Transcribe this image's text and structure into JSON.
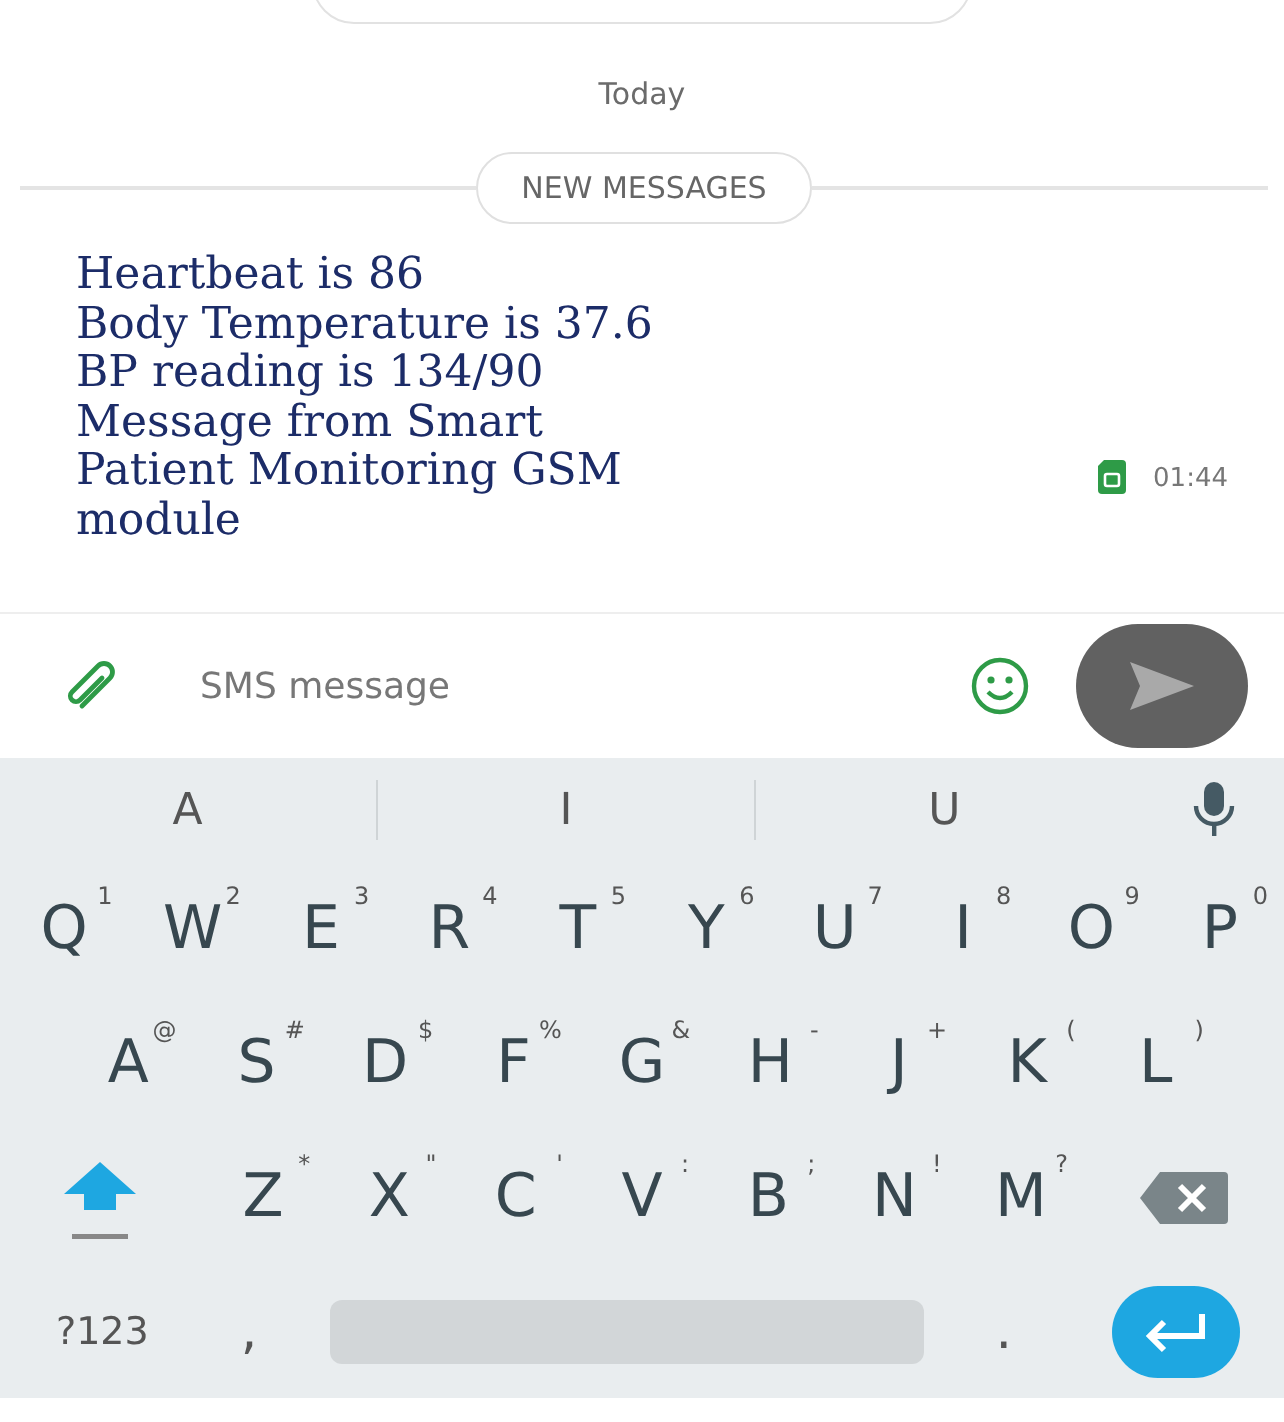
{
  "date_separator": "Today",
  "new_messages_label": "NEW MESSAGES",
  "message": {
    "lines": [
      "Heartbeat is 86",
      "Body Temperature is 37.6",
      "BP reading is 134/90",
      "Message from Smart",
      "Patient Monitoring GSM",
      "module"
    ],
    "time": "01:44"
  },
  "composer": {
    "placeholder": "SMS message"
  },
  "keyboard": {
    "suggestions": [
      "A",
      "I",
      "U"
    ],
    "rows": [
      [
        {
          "key": "Q",
          "hint": "1"
        },
        {
          "key": "W",
          "hint": "2"
        },
        {
          "key": "E",
          "hint": "3"
        },
        {
          "key": "R",
          "hint": "4"
        },
        {
          "key": "T",
          "hint": "5"
        },
        {
          "key": "Y",
          "hint": "6"
        },
        {
          "key": "U",
          "hint": "7"
        },
        {
          "key": "I",
          "hint": "8"
        },
        {
          "key": "O",
          "hint": "9"
        },
        {
          "key": "P",
          "hint": "0"
        }
      ],
      [
        {
          "key": "A",
          "hint": "@"
        },
        {
          "key": "S",
          "hint": "#"
        },
        {
          "key": "D",
          "hint": "$"
        },
        {
          "key": "F",
          "hint": "%"
        },
        {
          "key": "G",
          "hint": "&"
        },
        {
          "key": "H",
          "hint": "-"
        },
        {
          "key": "J",
          "hint": "+"
        },
        {
          "key": "K",
          "hint": "("
        },
        {
          "key": "L",
          "hint": ")"
        }
      ],
      [
        {
          "key": "Z",
          "hint": "*"
        },
        {
          "key": "X",
          "hint": "\""
        },
        {
          "key": "C",
          "hint": "'"
        },
        {
          "key": "V",
          "hint": ":"
        },
        {
          "key": "B",
          "hint": ";"
        },
        {
          "key": "N",
          "hint": "!"
        },
        {
          "key": "M",
          "hint": "?"
        }
      ]
    ],
    "symbols_key": "?123",
    "comma_key": ",",
    "period_key": "."
  }
}
